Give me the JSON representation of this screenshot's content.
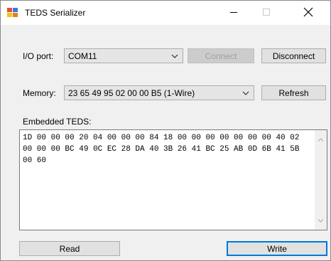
{
  "window": {
    "title": "TEDS Serializer"
  },
  "io_port": {
    "label": "I/O port:",
    "value": "COM11"
  },
  "buttons": {
    "connect": "Connect",
    "disconnect": "Disconnect",
    "refresh": "Refresh",
    "read": "Read",
    "write": "Write"
  },
  "memory": {
    "label": "Memory:",
    "value": "23 65 49 95 02 00 00 B5 (1-Wire)"
  },
  "teds": {
    "label": "Embedded TEDS:",
    "content": "1D 00 00 00 20 04 00 00 00 84 18 00 00 00 00 00 00 00 40 02 00 00 00 BC 49 0C EC 28 DA 40 3B 26 41 BC 25 AB 0D 6B 41 5B 00 60"
  },
  "icons": {
    "app": "app-icon",
    "minimize": "minimize-icon",
    "maximize": "maximize-icon",
    "close": "close-icon",
    "chevron": "chevron-down-icon"
  }
}
